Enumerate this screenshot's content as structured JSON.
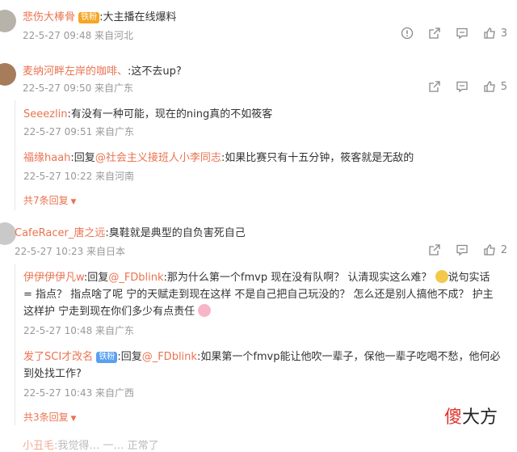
{
  "c1": {
    "name": "悲伤大棒骨",
    "badge": "铁粉",
    "text": ":大主播在线爆料",
    "time": "22-5-27 09:48 来自河北",
    "likes": "3"
  },
  "c2": {
    "name": "麦纳河畔左岸的咖啡、",
    "text": ":这不去up?",
    "time": "22-5-27 09:50 来自广东",
    "likes": "5",
    "replies": [
      {
        "name": "Seeezlin",
        "text": ":有没有一种可能，现在的ning真的不如筱客",
        "time": "22-5-27 09:51 来自广东"
      },
      {
        "name": "福缘haah",
        "pre": ":回复",
        "at": "@社会主义接班人小李同志",
        "text": ":如果比赛只有十五分钟，筱客就是无敌的",
        "time": "22-5-27 10:22 来自河南"
      }
    ],
    "more": "共7条回复"
  },
  "c3": {
    "name": "CafeRacer_唐之远",
    "text": ":臭鞋就是典型的自负害死自己",
    "time": "22-5-27 10:23 来自日本",
    "likes": "2",
    "r1": {
      "name": "伊伊伊伊凡w",
      "pre": ":回复",
      "at": "@_FDblink",
      "line1a": ":那为什么第一个fmvp 现在没有队啊？ 认清现实这么难？ ",
      "line1b": "说句实话",
      "line2": "= 指点？ 指点啥了呢 宁的天赋走到现在这样 不是自己把自己玩没的？ 怎么还是别人搞他不成？ 护主",
      "line3": "这样护 宁走到现在你们多少有点责任",
      "time": "22-5-27 10:48 来自广东"
    },
    "r2": {
      "name": "发了SCI才改名",
      "badge": "铁粉",
      "pre": ":回复",
      "at": "@_FDblink",
      "line1": ":如果第一个fmvp能让他吹一辈子，保他一辈子吃喝不愁，他何必",
      "line2": "到处找工作?",
      "time": "22-5-27 10:43 来自广西"
    },
    "more": "共3条回复"
  },
  "watermark": {
    "red": "傻",
    "rest": "大方"
  },
  "footer": {
    "name": "小丑毛",
    "text": ":我觉得… 一… 正常了"
  }
}
